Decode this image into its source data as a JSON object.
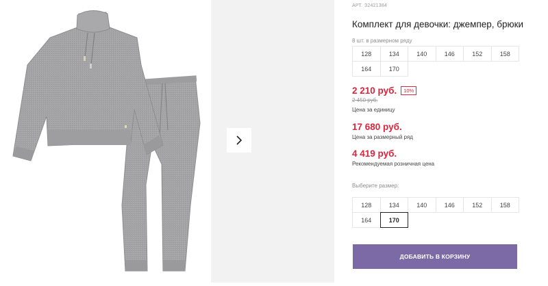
{
  "product": {
    "art_label": "АРТ.",
    "art_number": "32421384",
    "title": "Комплект для девочки: джемпер, брюки",
    "set_count_label": "8 шт. в размерном ряду",
    "set_sizes": [
      "128",
      "134",
      "140",
      "146",
      "152",
      "158",
      "164",
      "170"
    ],
    "price_unit": "2 210 руб.",
    "discount": "10%",
    "old_price": "2 450 руб.",
    "price_unit_label": "Цена за единицу",
    "price_set": "17 680 руб.",
    "price_set_label": "Цена за размерный ряд",
    "price_rrp": "4 419 руб.",
    "price_rrp_label": "Рекомендуемая розничная цена",
    "choose_size_label": "Выберите размер:",
    "sizes": [
      "128",
      "134",
      "140",
      "146",
      "152",
      "158",
      "164",
      "170"
    ],
    "selected_size": "170",
    "add_to_cart": "ДОБАВИТЬ В КОРЗИНУ"
  },
  "colors": {
    "accent_red": "#d7263d",
    "button_purple": "#7b6aa6",
    "knit_gray": "#a2a2a4"
  },
  "icons": {
    "next": "chevron-right-icon"
  }
}
